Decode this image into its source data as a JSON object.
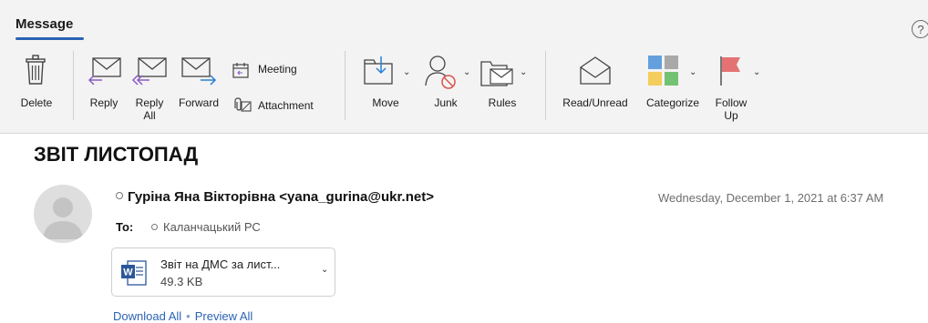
{
  "ribbon": {
    "tab": "Message",
    "help_icon": "?",
    "buttons": {
      "delete": "Delete",
      "reply": "Reply",
      "reply_all": "Reply\nAll",
      "forward": "Forward",
      "meeting": "Meeting",
      "attachment": "Attachment",
      "move": "Move",
      "junk": "Junk",
      "rules": "Rules",
      "read_unread": "Read/Unread",
      "categorize": "Categorize",
      "follow_up": "Follow\nUp"
    },
    "category_colors": [
      "#4a90d9",
      "#9b9b9b",
      "#f5c542",
      "#5cb85c"
    ],
    "flag_color": "#e05a5a"
  },
  "email": {
    "subject": "ЗВІТ ЛИСТОПАД",
    "from": "Гуріна Яна Вікторівна <yana_gurina@ukr.net>",
    "date": "Wednesday, December 1, 2021 at 6:37 AM",
    "to_label": "To:",
    "to": "Каланчацький РС"
  },
  "attachment": {
    "name": "Звіт на ДМС за лист...",
    "size": "49.3 KB",
    "icon": "word-document-icon"
  },
  "actions": {
    "download_all": "Download All",
    "separator": "•",
    "preview_all": "Preview All"
  }
}
